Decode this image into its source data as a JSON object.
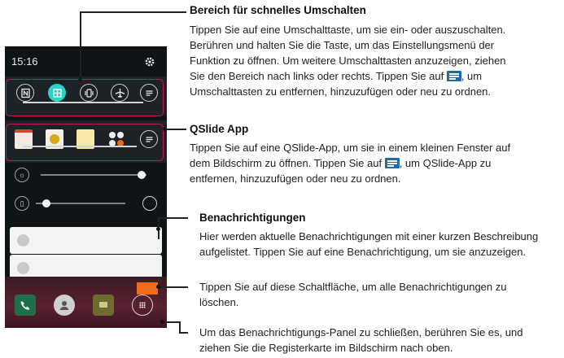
{
  "phone": {
    "clock": "15:16",
    "colors": {
      "accent_teal": "#2ad1c4",
      "highlight": "#c2185b",
      "clear_button": "#f06a1c"
    },
    "quick_toggles": [
      "nfc-icon",
      "qslide-icon",
      "vibrate-icon",
      "airplane-icon",
      "edit-list-icon"
    ],
    "qslide_apps": [
      "calendar-app-icon",
      "memo-app-icon",
      "notes-app-icon",
      "more-apps-icon",
      "edit-list-icon"
    ],
    "brightness_level": 0.95,
    "volume_level": 0.12
  },
  "sections": [
    {
      "heading": "Bereich für schnelles Umschalten",
      "body": [
        "Tippen Sie auf eine Umschalttaste, um sie ein- oder auszuschalten.",
        "Berühren und halten Sie die Taste, um das Einstellungsmenü der",
        "Funktion zu öffnen. Um weitere Umschalttasten anzuzeigen, ziehen",
        "Sie den Bereich nach links oder rechts. Tippen Sie auf",
        ", um",
        "Umschalttasten zu entfernen, hinzuzufügen oder neu zu ordnen."
      ]
    },
    {
      "heading": "QSlide App",
      "body": [
        "Tippen Sie auf eine QSlide-App, um sie in einem kleinen Fenster auf",
        "dem Bildschirm zu öffnen. Tippen Sie auf",
        ", um QSlide-App zu",
        "entfernen, hinzuzufügen oder neu zu ordnen."
      ]
    },
    {
      "heading": "Benachrichtigungen",
      "body": [
        "Hier werden aktuelle Benachrichtigungen mit einer kurzen Beschreibung",
        "aufgelistet. Tippen Sie auf eine Benachrichtigung, um sie anzuzeigen."
      ]
    },
    {
      "heading": "",
      "body": [
        "Tippen Sie auf diese Schaltfläche, um alle Benachrichtigungen zu",
        "löschen."
      ]
    },
    {
      "heading": "",
      "body": [
        "Um das Benachrichtigungs-Panel zu schließen, berühren Sie es, und",
        "ziehen Sie die Registerkarte im Bildschirm nach oben."
      ]
    }
  ]
}
